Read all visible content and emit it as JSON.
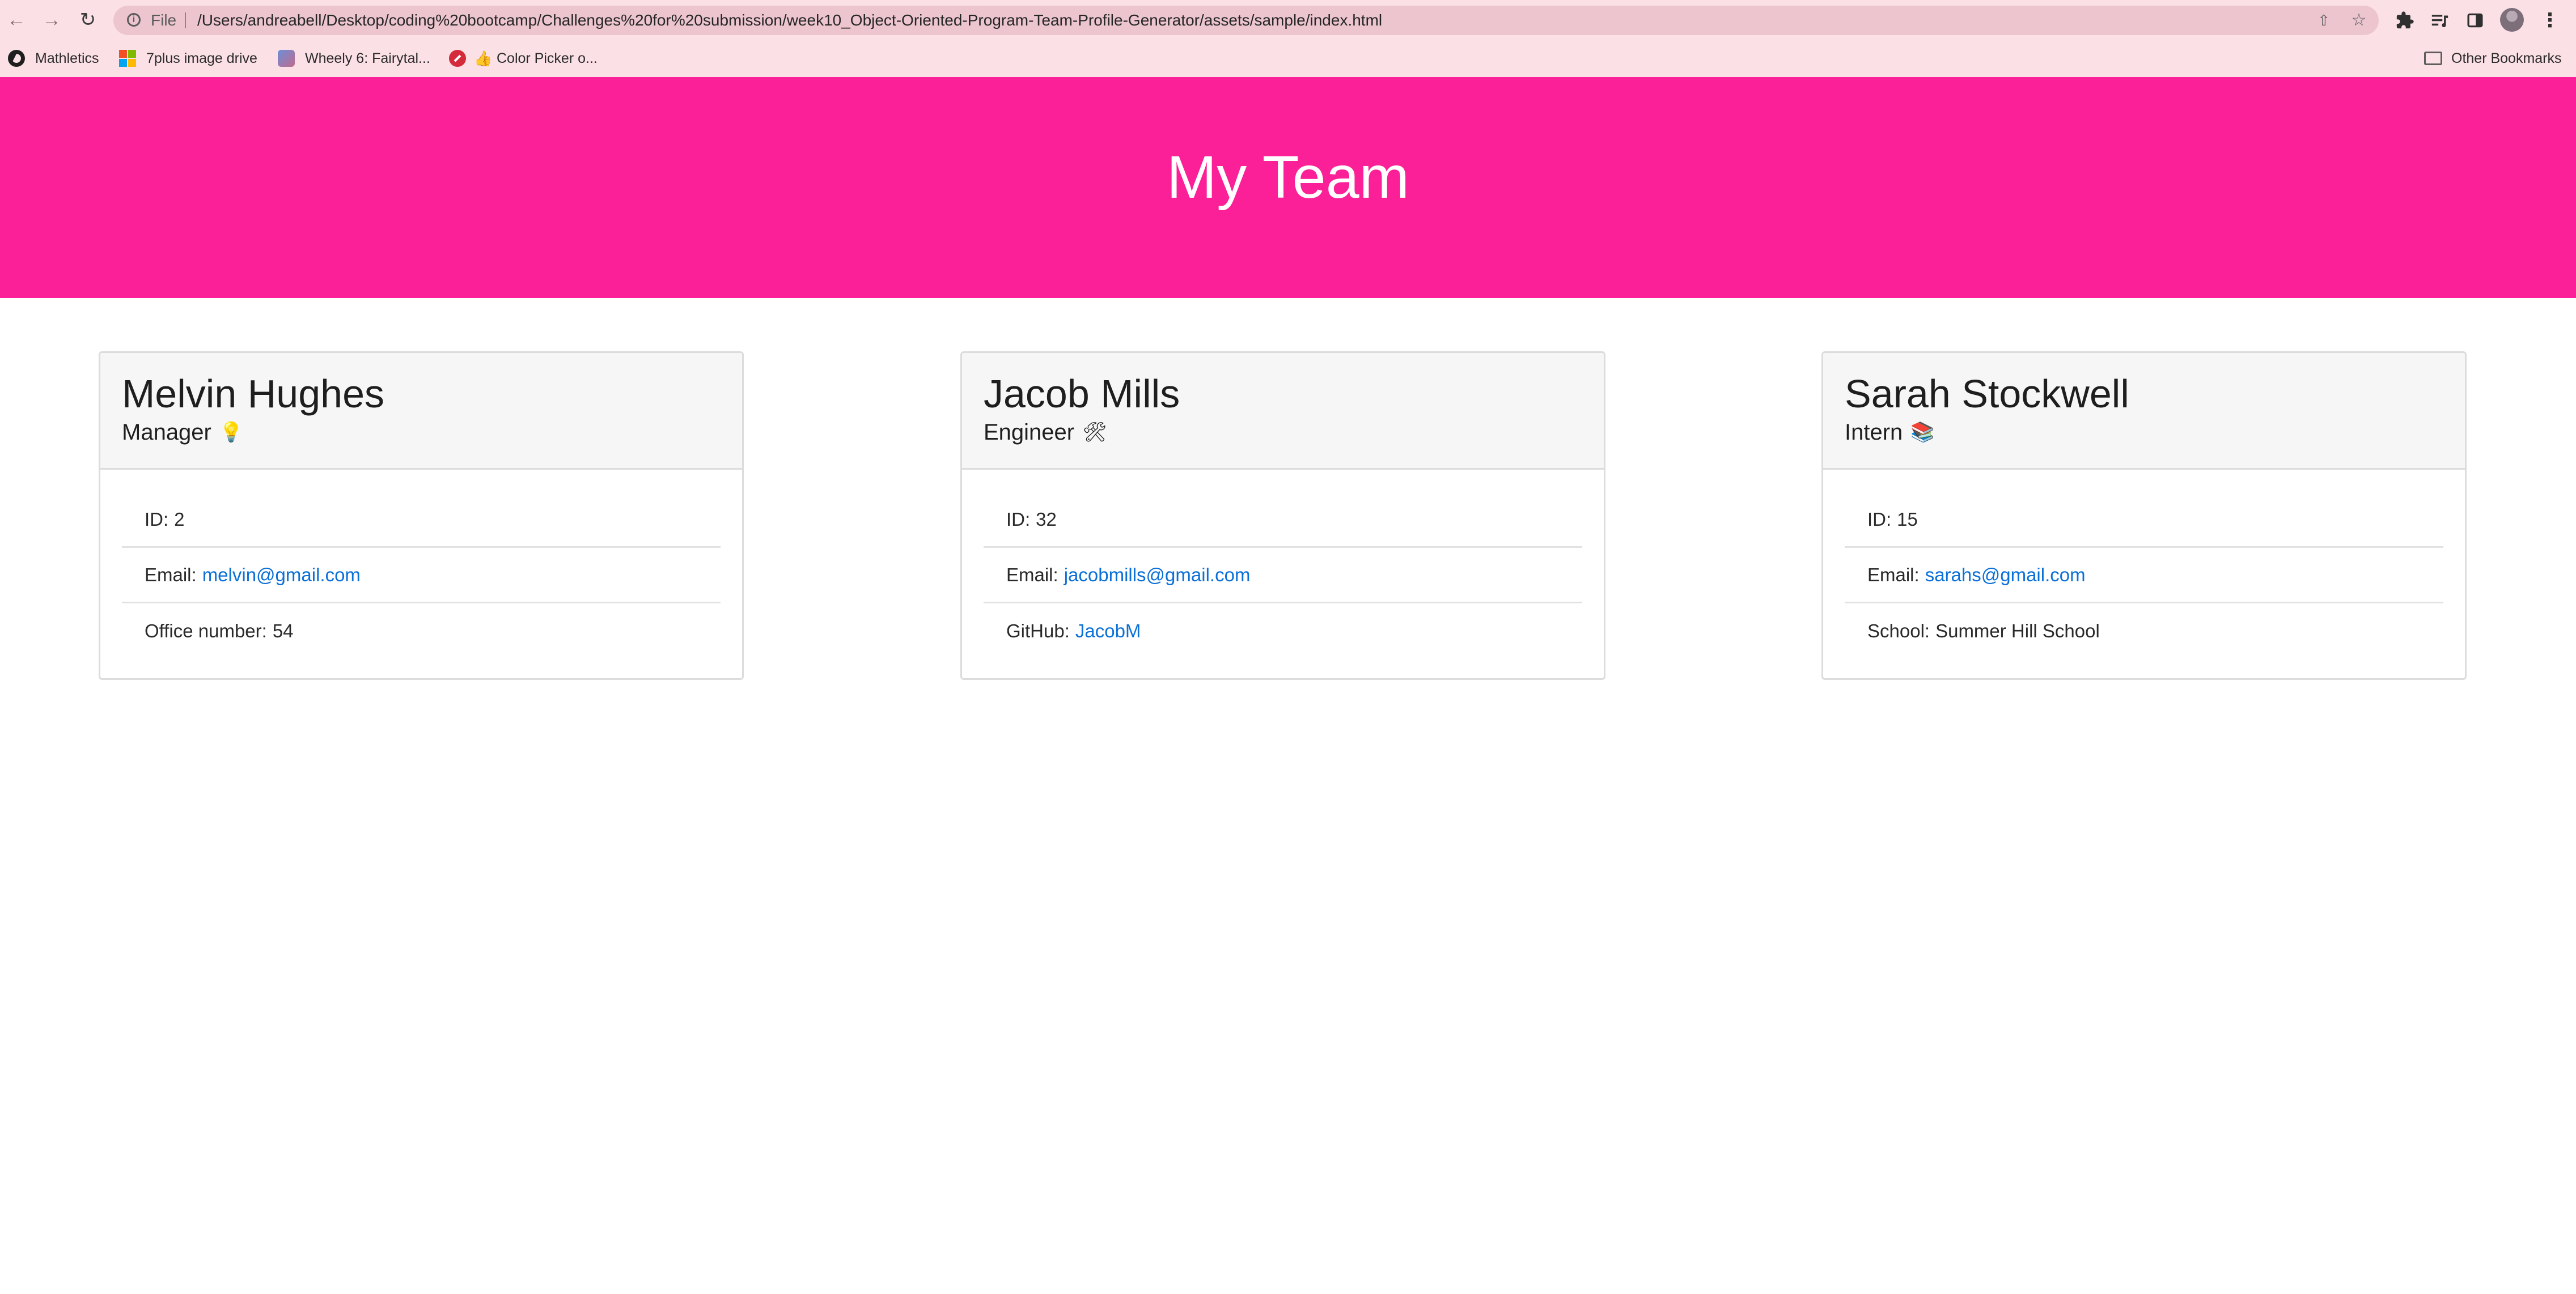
{
  "browser": {
    "scheme_label": "File",
    "url": "/Users/andreabell/Desktop/coding%20bootcamp/Challenges%20for%20submission/week10_Object-Oriented-Program-Team-Profile-Generator/assets/sample/index.html",
    "bookmarks": [
      {
        "label": "Mathletics",
        "icon": "mathletics-icon"
      },
      {
        "label": "7plus image drive",
        "icon": "microsoft-icon"
      },
      {
        "label": "Wheely 6: Fairytal...",
        "icon": "game-icon"
      },
      {
        "label": "Color Picker o...",
        "icon": "thumbs-up-icon"
      }
    ],
    "other_bookmarks": "Other Bookmarks"
  },
  "page": {
    "title": "My Team"
  },
  "team": [
    {
      "name": "Melvin Hughes",
      "role": "Manager",
      "role_icon": "💡",
      "id_label": "ID:",
      "id": "2",
      "email_label": "Email:",
      "email": "melvin@gmail.com",
      "extra_label": "Office number:",
      "extra_value": "54"
    },
    {
      "name": "Jacob Mills",
      "role": "Engineer",
      "role_icon": "🛠",
      "id_label": "ID:",
      "id": "32",
      "email_label": "Email:",
      "email": "jacobmills@gmail.com",
      "extra_label": "GitHub:",
      "extra_value": "JacobM"
    },
    {
      "name": "Sarah Stockwell",
      "role": "Intern",
      "role_icon": "📚",
      "id_label": "ID:",
      "id": "15",
      "email_label": "Email:",
      "email": "sarahs@gmail.com",
      "extra_label": "School:",
      "extra_value": "Summer Hill School"
    }
  ],
  "colors": {
    "header_bg": "#fb2097",
    "link": "#0b70d8",
    "browser_chrome": "#fbe0e6"
  }
}
